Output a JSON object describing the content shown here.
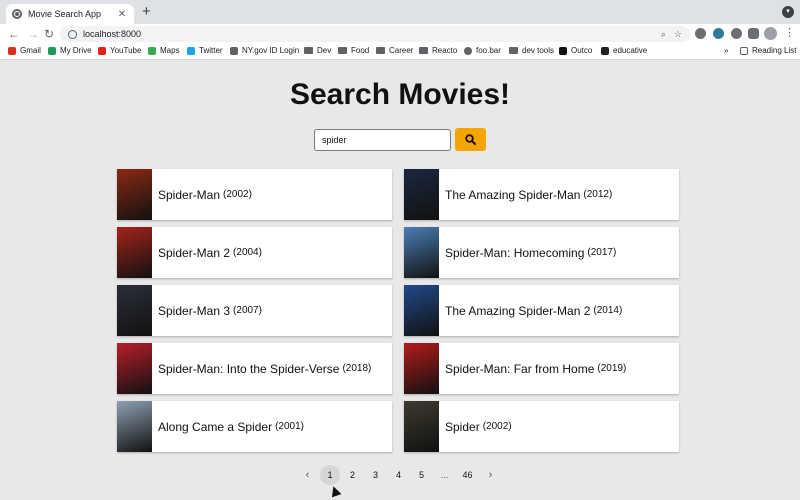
{
  "browser": {
    "tab_title": "Movie Search App",
    "url": "localhost:8000",
    "bookmarks": [
      "Gmail",
      "My Drive",
      "YouTube",
      "Maps",
      "Twitter",
      "NY.gov ID Login",
      "Dev",
      "Food",
      "Career",
      "Reacto",
      "foo.bar",
      "dev tools",
      "Outco",
      "educative"
    ],
    "reading_list": "Reading List",
    "more": "»"
  },
  "page": {
    "heading": "Search Movies!",
    "search_value": "spider"
  },
  "results": [
    {
      "title": "Spider-Man",
      "year": "(2002)",
      "color": "#8a2a12"
    },
    {
      "title": "The Amazing Spider-Man",
      "year": "(2012)",
      "color": "#1b2840"
    },
    {
      "title": "Spider-Man 2",
      "year": "(2004)",
      "color": "#a3241a"
    },
    {
      "title": "Spider-Man: Homecoming",
      "year": "(2017)",
      "color": "#4a7fb5"
    },
    {
      "title": "Spider-Man 3",
      "year": "(2007)",
      "color": "#2b2f3a"
    },
    {
      "title": "The Amazing Spider-Man 2",
      "year": "(2014)",
      "color": "#1f4a8a"
    },
    {
      "title": "Spider-Man: Into the Spider-Verse",
      "year": "(2018)",
      "color": "#b81e2b"
    },
    {
      "title": "Spider-Man: Far from Home",
      "year": "(2019)",
      "color": "#b51b1b"
    },
    {
      "title": "Along Came a Spider",
      "year": "(2001)",
      "color": "#8fa1b3"
    },
    {
      "title": "Spider",
      "year": "(2002)",
      "color": "#3e3a2f"
    }
  ],
  "pagination": {
    "prev": "‹",
    "pages": [
      "1",
      "2",
      "3",
      "4",
      "5",
      "...",
      "46"
    ],
    "next": "›",
    "current": "1"
  }
}
